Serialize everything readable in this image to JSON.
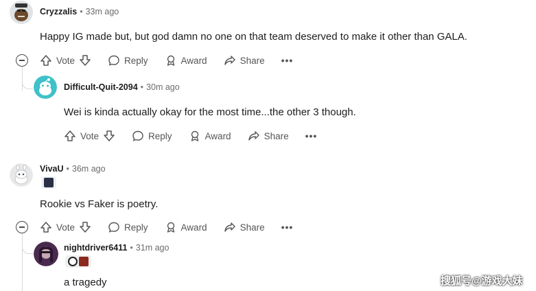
{
  "comments": [
    {
      "user": "Cryzzalis",
      "time": "33m ago",
      "text": "Happy IG made but, but god damn no one on that team deserved to make it other than GALA."
    },
    {
      "user": "Difficult-Quit-2094",
      "time": "30m ago",
      "text": "Wei is kinda actually okay for the most time...the other 3 though."
    },
    {
      "user": "VivaU",
      "time": "36m ago",
      "text": "Rookie vs Faker is poetry."
    },
    {
      "user": "nightdriver6411",
      "time": "31m ago",
      "text": "a tragedy"
    }
  ],
  "actions": {
    "vote": "Vote",
    "reply": "Reply",
    "award": "Award",
    "share": "Share",
    "more": "•••"
  },
  "separator": "•",
  "watermark": "搜狐号@游戏大妹",
  "colors": {
    "text": "#1c1c1c",
    "muted": "#6b6b6b",
    "thread_line": "#d5d9dc",
    "snoo_teal": "#3fc1c9"
  }
}
